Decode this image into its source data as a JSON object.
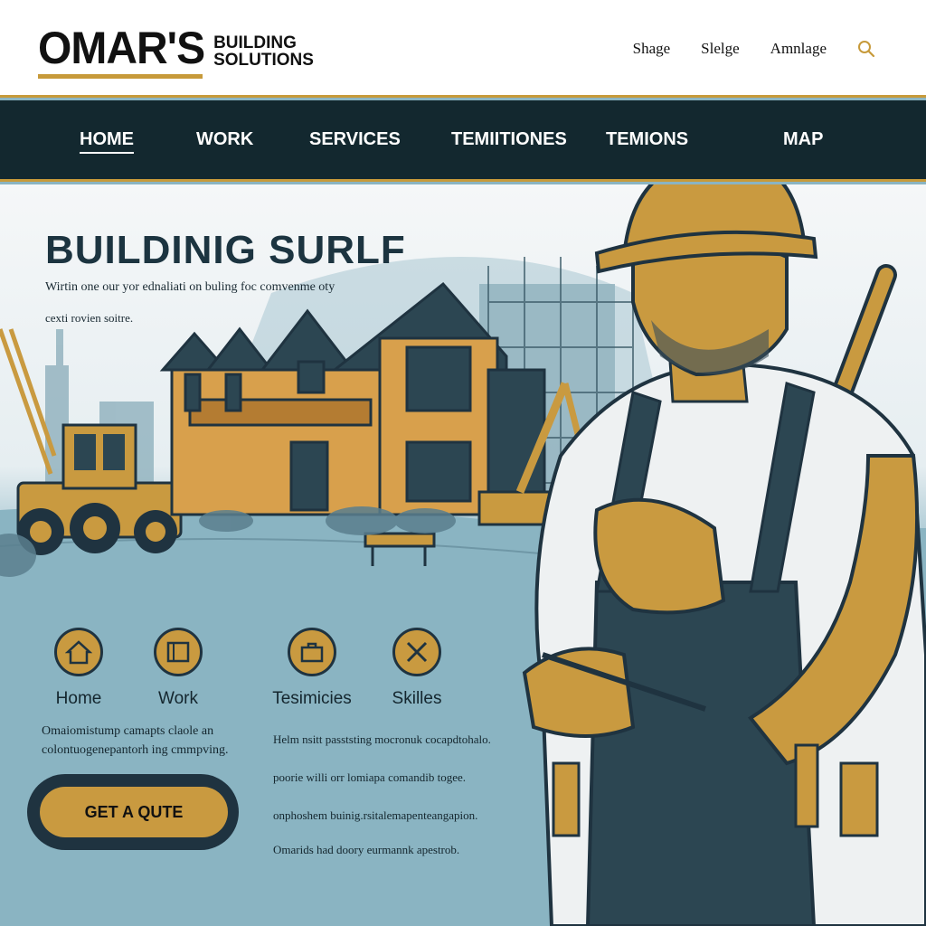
{
  "header": {
    "logo_main": "OMAR'S",
    "logo_sub_line1": "BUILDING",
    "logo_sub_line2": "SOLUTIONS",
    "links": [
      "Shage",
      "Slelge",
      "Amnlage"
    ]
  },
  "nav": {
    "items": [
      "HOME",
      "WORK",
      "SERVICES",
      "TEMIITIONES",
      "TEMIONS",
      "MAP"
    ],
    "active": "HOME"
  },
  "hero": {
    "title": "BUILDINIG SURLF",
    "subtitle_line1": "Wirtin one our yor ednaliati on buling foc comvenme oty",
    "subtitle_line2": "cexti rovien soitre."
  },
  "features": [
    {
      "label": "Home",
      "icon": "house-icon"
    },
    {
      "label": "Work",
      "icon": "blueprint-icon"
    },
    {
      "label": "Tesimicies",
      "icon": "toolbox-icon"
    },
    {
      "label": "Skilles",
      "icon": "crossed-tools-icon"
    }
  ],
  "blurb_left": "Omaiomistump camapts claole an colontuogenepantorh ing cmmpving.",
  "blurb_right": [
    "Helm nsitt pasststing mocronuk cocapdtohalo.",
    "poorie willi orr lomiapa comandib togee.",
    "onphoshem buinig.rsitalemapenteangapion.",
    "Omarids had doory eurmannk apestrob."
  ],
  "cta_label": "GET A QUTE",
  "colors": {
    "gold": "#c99a40",
    "navy": "#13282f",
    "sky": "#8ab4c2"
  }
}
